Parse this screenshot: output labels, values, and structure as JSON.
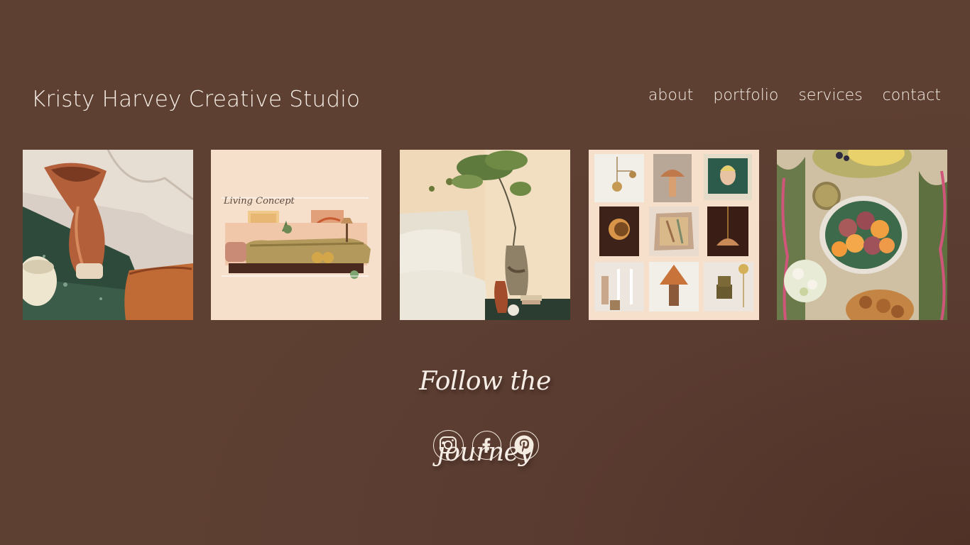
{
  "header": {
    "site_title": "Kristy Harvey Creative Studio"
  },
  "nav": {
    "items": [
      {
        "label": "about"
      },
      {
        "label": "portfolio"
      },
      {
        "label": "services"
      },
      {
        "label": "contact"
      }
    ]
  },
  "gallery": {
    "tiles": [
      {
        "subject": "terracotta vase on green marble"
      },
      {
        "subject": "living concept moodboard",
        "caption": "Living Concept"
      },
      {
        "subject": "vase with branch on nightstand"
      },
      {
        "subject": "lighting and decor grid"
      },
      {
        "subject": "fruit bowl on botanical tablecloth"
      }
    ]
  },
  "footer": {
    "tagline": "Follow the journey",
    "social": [
      {
        "icon": "instagram-icon"
      },
      {
        "icon": "facebook-icon"
      },
      {
        "icon": "pinterest-icon"
      }
    ]
  },
  "colors": {
    "background": "#5e4033",
    "text": "#f6eee6"
  }
}
